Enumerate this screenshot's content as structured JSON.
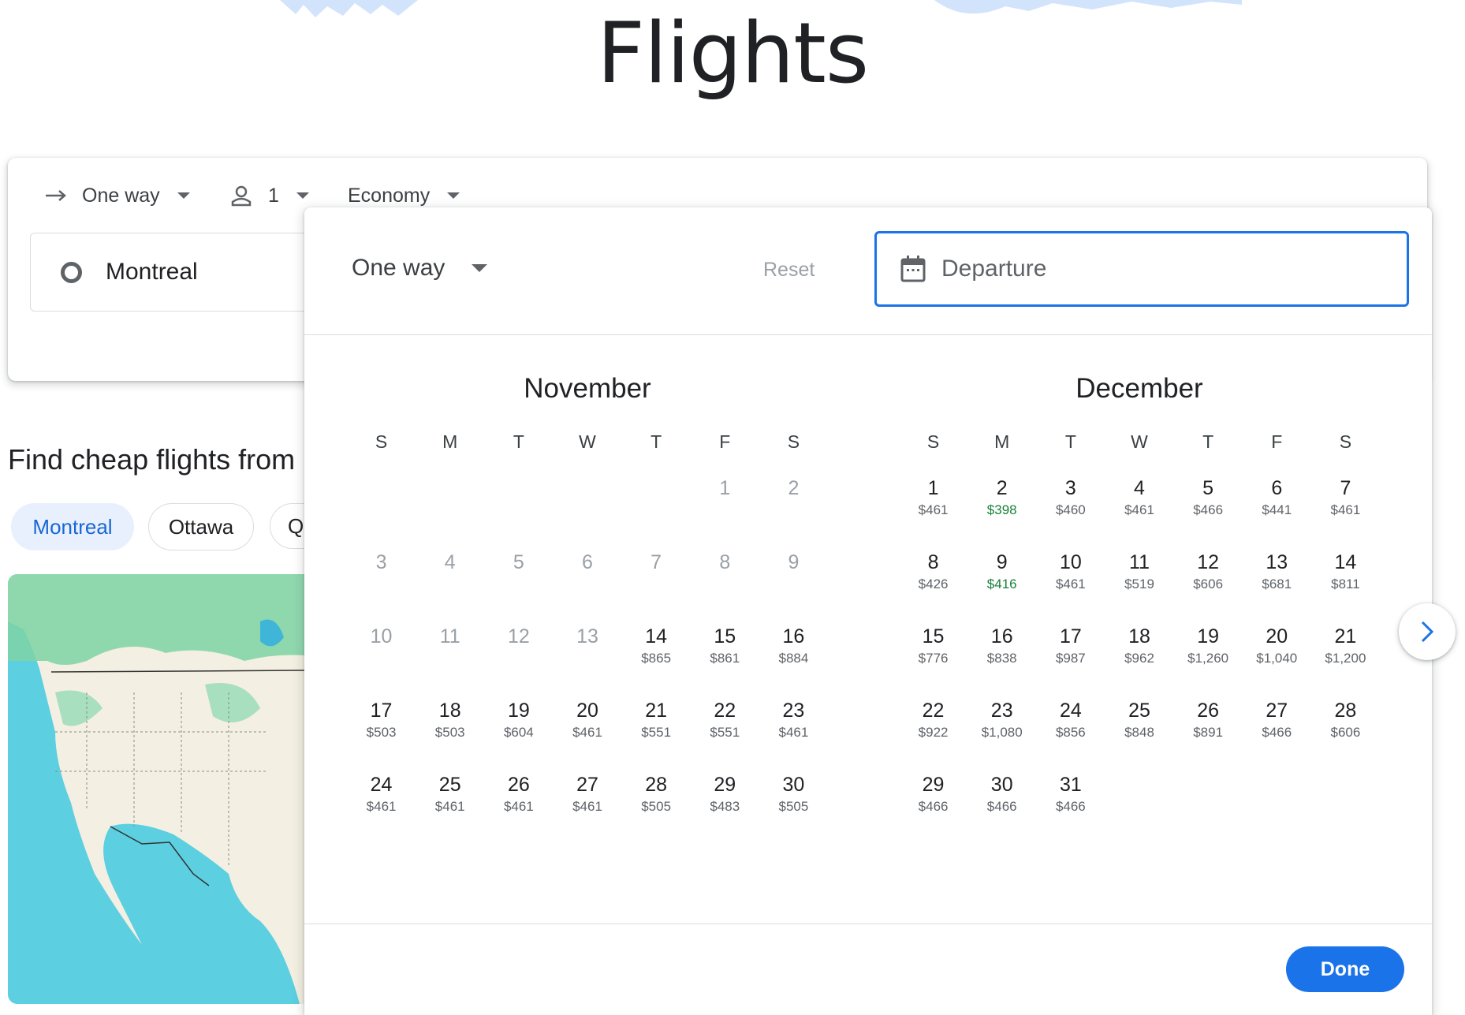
{
  "page": {
    "title": "Flights"
  },
  "search": {
    "trip_type": "One way",
    "passengers": "1",
    "cabin_class": "Economy",
    "origin": "Montreal"
  },
  "explore": {
    "title": "Find cheap flights from",
    "chips": [
      "Montreal",
      "Ottawa",
      "Q"
    ]
  },
  "picker": {
    "trip_type": "One way",
    "reset_label": "Reset",
    "departure_placeholder": "Departure",
    "done_label": "Done",
    "weekdays": [
      "S",
      "M",
      "T",
      "W",
      "T",
      "F",
      "S"
    ],
    "months": [
      {
        "name": "November",
        "weeks": [
          [
            null,
            null,
            null,
            null,
            null,
            {
              "d": "1",
              "dis": true
            },
            {
              "d": "2",
              "dis": true
            }
          ],
          [
            {
              "d": "3",
              "dis": true
            },
            {
              "d": "4",
              "dis": true
            },
            {
              "d": "5",
              "dis": true
            },
            {
              "d": "6",
              "dis": true
            },
            {
              "d": "7",
              "dis": true
            },
            {
              "d": "8",
              "dis": true
            },
            {
              "d": "9",
              "dis": true
            }
          ],
          [
            {
              "d": "10",
              "dis": true
            },
            {
              "d": "11",
              "dis": true
            },
            {
              "d": "12",
              "dis": true
            },
            {
              "d": "13",
              "dis": true
            },
            {
              "d": "14",
              "p": "$865"
            },
            {
              "d": "15",
              "p": "$861"
            },
            {
              "d": "16",
              "p": "$884"
            }
          ],
          [
            {
              "d": "17",
              "p": "$503"
            },
            {
              "d": "18",
              "p": "$503"
            },
            {
              "d": "19",
              "p": "$604"
            },
            {
              "d": "20",
              "p": "$461"
            },
            {
              "d": "21",
              "p": "$551"
            },
            {
              "d": "22",
              "p": "$551"
            },
            {
              "d": "23",
              "p": "$461"
            }
          ],
          [
            {
              "d": "24",
              "p": "$461"
            },
            {
              "d": "25",
              "p": "$461"
            },
            {
              "d": "26",
              "p": "$461"
            },
            {
              "d": "27",
              "p": "$461"
            },
            {
              "d": "28",
              "p": "$505"
            },
            {
              "d": "29",
              "p": "$483"
            },
            {
              "d": "30",
              "p": "$505"
            }
          ]
        ]
      },
      {
        "name": "December",
        "weeks": [
          [
            {
              "d": "1",
              "p": "$461"
            },
            {
              "d": "2",
              "p": "$398",
              "low": true
            },
            {
              "d": "3",
              "p": "$460"
            },
            {
              "d": "4",
              "p": "$461"
            },
            {
              "d": "5",
              "p": "$466"
            },
            {
              "d": "6",
              "p": "$441"
            },
            {
              "d": "7",
              "p": "$461"
            }
          ],
          [
            {
              "d": "8",
              "p": "$426"
            },
            {
              "d": "9",
              "p": "$416",
              "low": true
            },
            {
              "d": "10",
              "p": "$461"
            },
            {
              "d": "11",
              "p": "$519"
            },
            {
              "d": "12",
              "p": "$606"
            },
            {
              "d": "13",
              "p": "$681"
            },
            {
              "d": "14",
              "p": "$811"
            }
          ],
          [
            {
              "d": "15",
              "p": "$776"
            },
            {
              "d": "16",
              "p": "$838"
            },
            {
              "d": "17",
              "p": "$987"
            },
            {
              "d": "18",
              "p": "$962"
            },
            {
              "d": "19",
              "p": "$1,260"
            },
            {
              "d": "20",
              "p": "$1,040"
            },
            {
              "d": "21",
              "p": "$1,200"
            }
          ],
          [
            {
              "d": "22",
              "p": "$922"
            },
            {
              "d": "23",
              "p": "$1,080"
            },
            {
              "d": "24",
              "p": "$856"
            },
            {
              "d": "25",
              "p": "$848"
            },
            {
              "d": "26",
              "p": "$891"
            },
            {
              "d": "27",
              "p": "$466"
            },
            {
              "d": "28",
              "p": "$606"
            }
          ],
          [
            {
              "d": "29",
              "p": "$466"
            },
            {
              "d": "30",
              "p": "$466"
            },
            {
              "d": "31",
              "p": "$466"
            },
            null,
            null,
            null,
            null
          ]
        ]
      }
    ]
  },
  "colors": {
    "accent": "#1a73e8",
    "low_price": "#188038",
    "chip_selected_bg": "#e8f0fe",
    "chip_selected_text": "#1967d2",
    "text": "#202124",
    "muted": "#5f6368",
    "disabled": "#9aa0a6"
  },
  "icons": {
    "trip_type": "arrow-right-icon",
    "passengers": "person-icon",
    "origin": "circle-icon",
    "departure": "calendar-icon",
    "next": "chevron-right-icon",
    "dropdown": "caret-down-icon"
  }
}
